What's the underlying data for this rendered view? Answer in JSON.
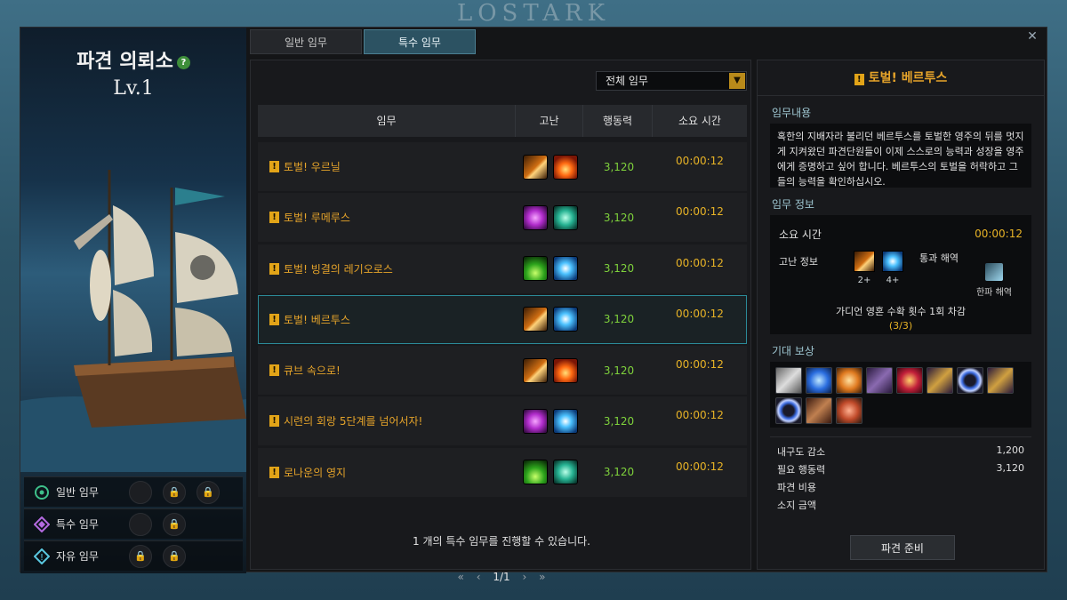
{
  "banner": "LOSTARK",
  "left": {
    "title": "파견 의뢰소",
    "level": "Lv.1",
    "modes": [
      {
        "label": "일반 임무",
        "icon": "normal-mission-icon"
      },
      {
        "label": "특수 임무",
        "icon": "special-mission-icon"
      },
      {
        "label": "자유 임무",
        "icon": "free-mission-icon"
      }
    ]
  },
  "tabs": [
    {
      "label": "일반 임무",
      "active": false
    },
    {
      "label": "특수 임무",
      "active": true
    }
  ],
  "filter": {
    "value": "전체 임무"
  },
  "table": {
    "headers": {
      "name": "임무",
      "hardship": "고난",
      "power": "행동력",
      "time": "소요 시간"
    },
    "rows": [
      {
        "name": "토벌! 우르닐",
        "hazards": [
          "blade",
          "fire"
        ],
        "power": "3,120",
        "time": "00:00:12",
        "selected": false
      },
      {
        "name": "토벌! 루메루스",
        "hazards": [
          "purple",
          "swirl"
        ],
        "power": "3,120",
        "time": "00:00:12",
        "selected": false
      },
      {
        "name": "토벌! 빙결의 레기오로스",
        "hazards": [
          "spike",
          "ice"
        ],
        "power": "3,120",
        "time": "00:00:12",
        "selected": false
      },
      {
        "name": "토벌! 베르투스",
        "hazards": [
          "blade",
          "ice"
        ],
        "power": "3,120",
        "time": "00:00:12",
        "selected": true
      },
      {
        "name": "큐브 속으로!",
        "hazards": [
          "blade",
          "fire"
        ],
        "power": "3,120",
        "time": "00:00:12",
        "selected": false
      },
      {
        "name": "시련의 회랑 5단계를 넘어서자!",
        "hazards": [
          "purple",
          "ice"
        ],
        "power": "3,120",
        "time": "00:00:12",
        "selected": false
      },
      {
        "name": "로나운의 영지",
        "hazards": [
          "spike",
          "swirl"
        ],
        "power": "3,120",
        "time": "00:00:12",
        "selected": false
      }
    ]
  },
  "notice": "1 개의 특수 임무를 진행할 수 있습니다.",
  "pager": {
    "first": "«",
    "prev": "‹",
    "page": "1/1",
    "next": "›",
    "last": "»"
  },
  "detail": {
    "title": "토벌! 베르투스",
    "section_content": "임무내용",
    "description": "혹한의 지배자라 불리던 베르투스를 토벌한 영주의 뒤를 멋지게 지켜왔던 파견단원들이 이제 스스로의 능력과 성장을 영주에게 증명하고 싶어 합니다. 베르투스의 토벌을 허락하고 그들의 능력을 확인하십시오.",
    "section_info": "임무 정보",
    "time_label": "소요 시간",
    "time_value": "00:00:12",
    "hardship_label": "고난 정보",
    "hardship_reqs": [
      "2+",
      "4+"
    ],
    "relief_label": "통과 해역",
    "relief_name": "한파 해역",
    "bonus_text": "가디언 영혼 수확 횟수 1회 차감",
    "bonus_count": "(3/3)",
    "section_reward": "기대 보상",
    "reward_icons": [
      "gray-stone-icon",
      "blue-gem-icon",
      "orange-gem-icon",
      "purple-box-icon",
      "red-gem-icon",
      "gold-staff-icon",
      "blue-ring-icon",
      "gold-staff-icon",
      "blue-ring-icon",
      "card-icon",
      "ore-icon"
    ],
    "costs": [
      {
        "label": "내구도 감소",
        "value": "1,200"
      },
      {
        "label": "필요 행동력",
        "value": "3,120"
      },
      {
        "label": "파견 비용",
        "value": ""
      },
      {
        "label": "소지 금액",
        "value": ""
      }
    ],
    "dispatch_label": "파견 준비"
  }
}
